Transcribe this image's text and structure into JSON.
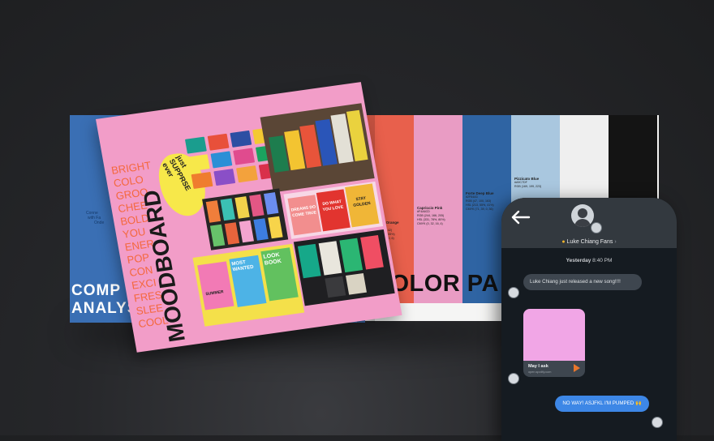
{
  "magazine": {
    "left_page": {
      "title_lines": [
        "COMP",
        "ANALYS"
      ],
      "side_text_lines": [
        "Conne",
        "with Fa",
        "Onde"
      ]
    },
    "moodboard": {
      "title": "MOODBOARD",
      "words": [
        "BRIGHT",
        "COLO",
        "GROO",
        "CHEE",
        "BOLD",
        "YOU",
        "ENER",
        "POP",
        "CON",
        "EXCI",
        "FRES",
        "SLEE",
        "COOL"
      ],
      "sticker_text": "just SUPPRSE ever",
      "poster_texts": [
        "DREAMS DO COME TRUE",
        "DO WHAT YOU LOVE",
        "STAY GOLDEN",
        "LOOK BOOK",
        "MOST WANTED",
        "SUMMER"
      ]
    },
    "right_page": {
      "heading": "COLOR PA",
      "swatches": [
        {
          "name": "Camarillo Orange",
          "hex": "#E8604C",
          "values": [
            "#F05A2A",
            "RGB (240, 90, 42)",
            "HSL (15, 87%, 55%)",
            "CMYK (0, 62, 82, 6)"
          ]
        },
        {
          "name": "Capriccio Pink",
          "hex": "#E99CC4",
          "values": [
            "#F4A6CD",
            "RGB (244, 166, 205)",
            "HSL (331, 78%, 80%)",
            "CMYK (0, 32, 16, 4)"
          ]
        },
        {
          "name": "Forte Deep Blue",
          "hex": "#2F64A3",
          "values": [
            "#2F64A3",
            "RGB (47, 100, 163)",
            "HSL (213, 55%, 41%)",
            "CMYK (71, 39, 0, 36)"
          ]
        },
        {
          "name": "Pizzicato Blue",
          "hex": "#A9C7DF",
          "values": [
            "#A9C7DF",
            "RGB (169, 199, 223)"
          ]
        },
        {
          "name": "",
          "hex": "#EFEFEF",
          "values": []
        },
        {
          "name": "",
          "hex": "#141414",
          "values": []
        }
      ]
    }
  },
  "phone": {
    "group_name": "Luke Chiang Fans",
    "timestamp_day": "Yesterday",
    "timestamp_time": "8:40 PM",
    "message_in": "Luke Chiang just released a new song!!!!",
    "music_card": {
      "title": "May I ask",
      "subtitle": "open.spotify.com"
    },
    "message_out": "NO WAY! ASJFKL I'M PUMPED 🙌",
    "colors": {
      "header": "#33393F",
      "background": "#151B21",
      "incoming": "#3E464F",
      "outgoing": "#3D87E6",
      "card_art": "#F1A6E6"
    }
  }
}
